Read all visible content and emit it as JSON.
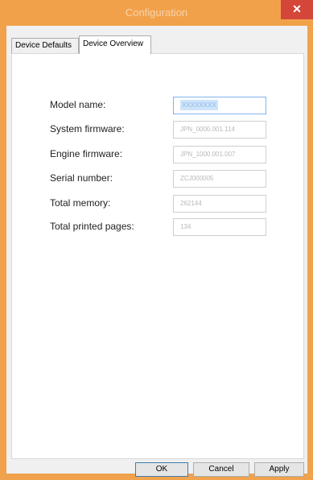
{
  "window": {
    "title": "Configuration",
    "close_glyph": "✕",
    "accent": "#f0a24c"
  },
  "tabs": [
    {
      "label": "Device Defaults",
      "active": false
    },
    {
      "label": "Device Overview",
      "active": true
    }
  ],
  "overview": {
    "rows": [
      {
        "label": "Model name:",
        "value": "XXXXXXXX",
        "selected": true
      },
      {
        "label": "System firmware:",
        "value": "JPN_0000.001.114",
        "selected": false
      },
      {
        "label": "Engine firmware:",
        "value": "JPN_1000.001.007",
        "selected": false
      },
      {
        "label": "Serial number:",
        "value": "ZCJ000005",
        "selected": false
      },
      {
        "label": "Total memory:",
        "value": "262144",
        "selected": false
      },
      {
        "label": "Total printed pages:",
        "value": "134",
        "selected": false
      }
    ]
  },
  "buttons": {
    "ok": "OK",
    "cancel": "Cancel",
    "apply": "Apply"
  }
}
